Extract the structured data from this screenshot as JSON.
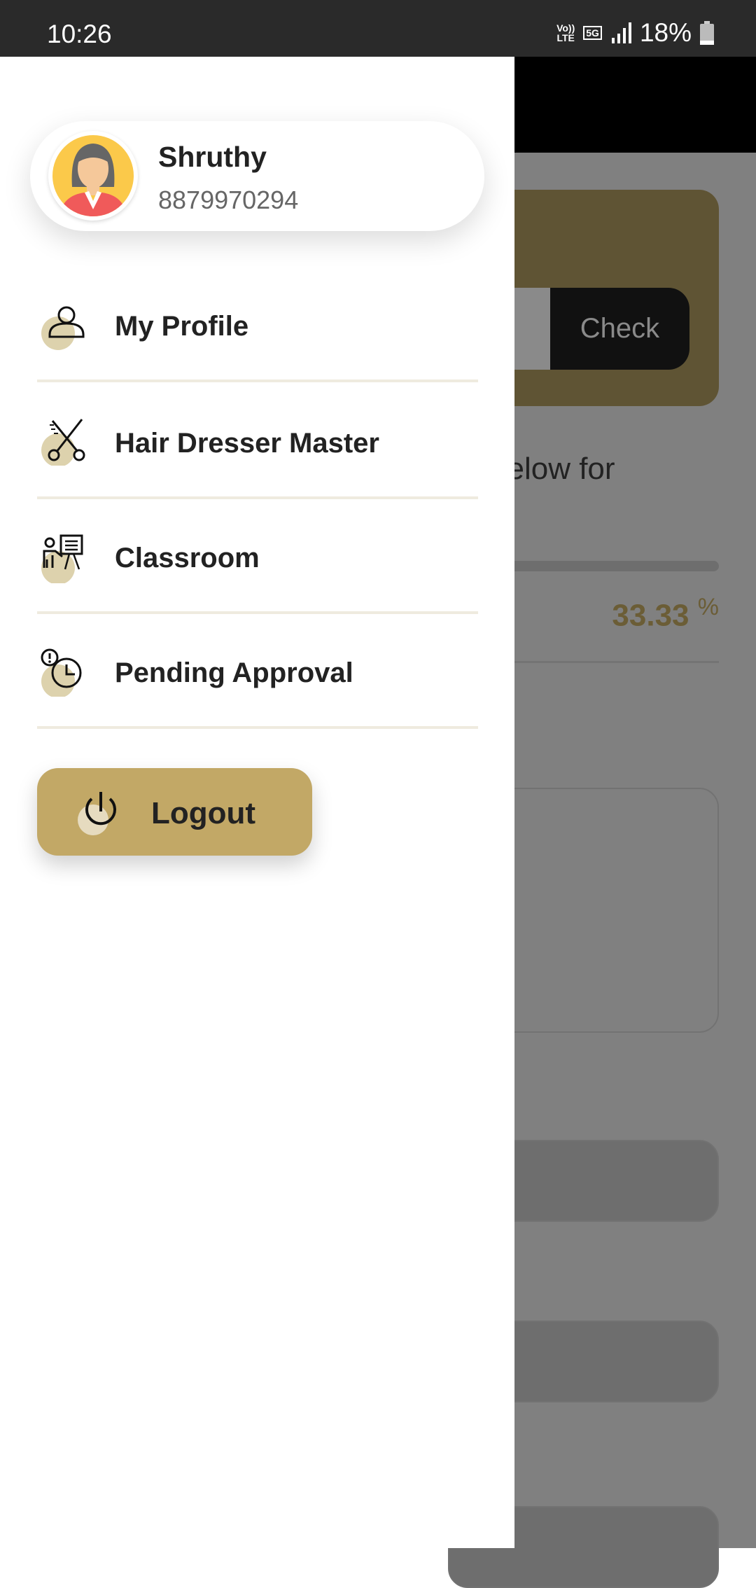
{
  "status_bar": {
    "time": "10:26",
    "volte": "Vo)) LTE",
    "network": "5G",
    "battery": "18%"
  },
  "drawer": {
    "user": {
      "name": "Shruthy",
      "phone": "8879970294"
    },
    "menu": [
      {
        "label": "My Profile",
        "icon": "user-icon"
      },
      {
        "label": "Hair Dresser Master",
        "icon": "scissors-icon"
      },
      {
        "label": "Classroom",
        "icon": "classroom-icon"
      },
      {
        "label": "Pending Approval",
        "icon": "pending-clock-icon"
      }
    ],
    "logout_label": "Logout"
  },
  "background": {
    "check_label": "Check",
    "partial_text": "below for",
    "progress_percent": "33.33",
    "percent_sign": "%"
  },
  "colors": {
    "accent": "#c2a866",
    "dark_card": "#5f5434",
    "overlay": "#808080"
  }
}
